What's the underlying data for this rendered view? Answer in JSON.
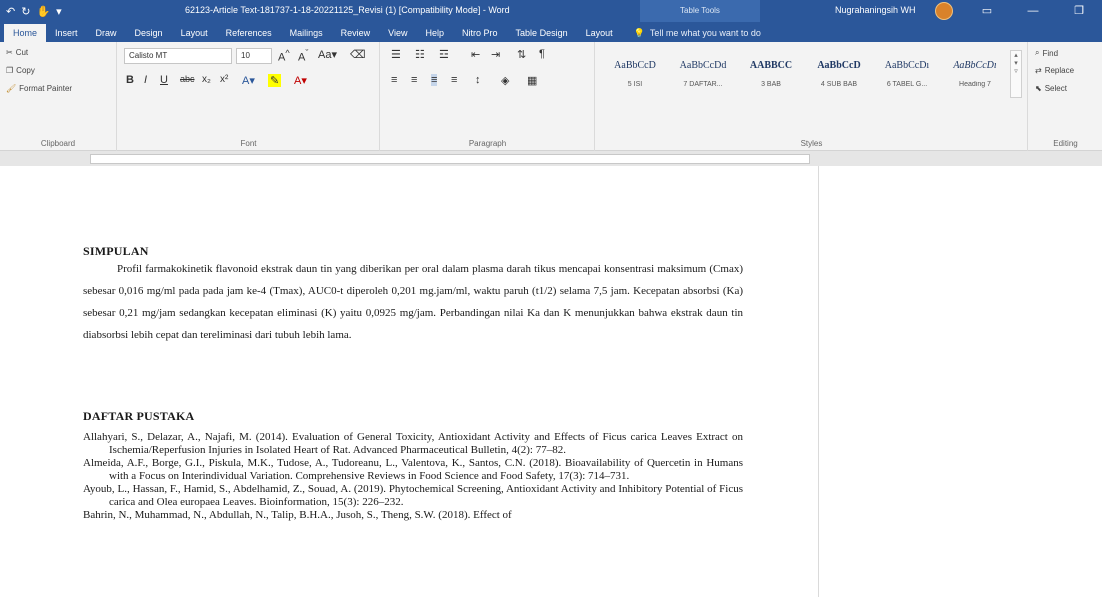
{
  "titlebar": {
    "doc_title": "62123-Article Text-181737-1-18-20221125_Revisi (1) [Compatibility Mode] - Word",
    "table_tools": "Table Tools",
    "user_name": "Nugrahaningsih WH"
  },
  "tabs": [
    "Insert",
    "Draw",
    "Design",
    "Layout",
    "References",
    "Mailings",
    "Review",
    "View",
    "Help",
    "Nitro Pro",
    "Table Design",
    "Layout"
  ],
  "active_tab": "Home",
  "tell_me": "Tell me what you want to do",
  "clipboard": {
    "cut": "Cut",
    "copy": "Copy",
    "format_painter": "Format Painter",
    "label": "Clipboard"
  },
  "font": {
    "name": "Calisto MT",
    "size": "10",
    "label": "Font"
  },
  "paragraph": {
    "label": "Paragraph"
  },
  "styles": {
    "label": "Styles",
    "items": [
      {
        "sample": "AaBbCcD",
        "name": "5 ISI"
      },
      {
        "sample": "AaBbCcDd",
        "name": "7 DAFTAR..."
      },
      {
        "sample": "AABBCC",
        "name": "3 BAB"
      },
      {
        "sample": "AaBbCcD",
        "name": "4 SUB BAB"
      },
      {
        "sample": "AaBbCcDı",
        "name": "6 TABEL G..."
      },
      {
        "sample": "AaBbCcDı",
        "name": "Heading 7"
      }
    ]
  },
  "editing": {
    "find": "Find",
    "replace": "Replace",
    "select": "Select",
    "label": "Editing"
  },
  "document": {
    "simpulan_heading": "SIMPULAN",
    "simpulan_text": "Profil farmakokinetik flavonoid ekstrak daun tin yang diberikan per oral dalam plasma darah tikus mencapai konsentrasi maksimum (Cmax) sebesar 0,016 mg/ml pada pada jam ke-4 (Tmax), AUC0-t diperoleh 0,201 mg.jam/ml, waktu paruh (t1/2) selama 7,5 jam. Kecepatan absorbsi (Ka) sebesar 0,21 mg/jam sedangkan kecepatan eliminasi (K) yaitu 0,0925 mg/jam. Perbandingan nilai Ka dan K menunjukkan bahwa ekstrak daun tin diabsorbsi lebih cepat dan tereliminasi dari tubuh lebih lama.",
    "daftar_heading": "DAFTAR PUSTAKA",
    "references": [
      "Allahyari, S., Delazar, A., Najafi, M. (2014). Evaluation of General Toxicity, Antioxidant Activity and Effects of Ficus carica Leaves Extract on Ischemia/Reperfusion Injuries in Isolated Heart of Rat. Advanced Pharmaceutical Bulletin, 4(2): 77–82.",
      "Almeida, A.F., Borge, G.I., Piskula, M.K., Tudose, A., Tudoreanu, L., Valentova, K., Santos, C.N. (2018). Bioavailability of Quercetin in Humans with a Focus on Interindividual Variation. Comprehensive Reviews in Food Science and Food Safety, 17(3): 714–731.",
      "Ayoub, L., Hassan, F., Hamid, S., Abdelhamid, Z., Souad, A. (2019). Phytochemical Screening, Antioxidant Activity and Inhibitory Potential of Ficus carica and Olea europaea Leaves. Bioinformation, 15(3): 226–232.",
      "Bahrin, N., Muhammad, N., Abdullah, N., Talip, B.H.A., Jusoh, S., Theng, S.W. (2018). Effect of"
    ]
  },
  "colors": {
    "title_bar": "#2b579a",
    "ribbon": "#f3f3f3",
    "workspace": "#e6e6e6"
  }
}
